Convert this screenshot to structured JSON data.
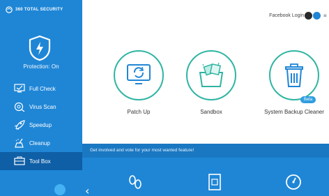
{
  "app": {
    "title": "360 TOTAL SECURITY"
  },
  "sidebar": {
    "protection": "Protection: On",
    "items": [
      {
        "label": "Full Check",
        "icon": "monitor-check-icon"
      },
      {
        "label": "Virus Scan",
        "icon": "virus-scan-icon"
      },
      {
        "label": "Speedup",
        "icon": "rocket-icon"
      },
      {
        "label": "Cleanup",
        "icon": "broom-icon"
      },
      {
        "label": "Tool Box",
        "icon": "toolbox-icon",
        "active": true
      }
    ]
  },
  "header": {
    "facebook_login": "Facebook Login"
  },
  "tools": [
    {
      "label": "Patch Up",
      "icon": "patch-up-monitor-icon"
    },
    {
      "label": "Sandbox",
      "icon": "sandbox-box-icon"
    },
    {
      "label": "System Backup Cleaner",
      "icon": "trash-can-icon",
      "badge": "Beta"
    }
  ],
  "band": {
    "text": "Get involved and vote for your most wanted feature!"
  },
  "bottom_icons": [
    "footprints-icon",
    "document-icon",
    "gauge-icon"
  ],
  "colors": {
    "sidebar": "#1f86d6",
    "active": "#0f5fa6",
    "accent": "#2fb5a3"
  }
}
